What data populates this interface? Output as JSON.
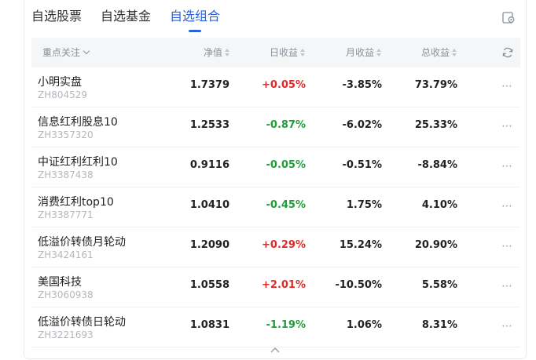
{
  "tabs": [
    {
      "label": "自选股票",
      "active": false
    },
    {
      "label": "自选基金",
      "active": false
    },
    {
      "label": "自选组合",
      "active": true
    }
  ],
  "header": {
    "focus": "重点关注",
    "nav": "净值",
    "day": "日收益",
    "month": "月收益",
    "total": "总收益"
  },
  "colors": {
    "accent": "#2b63d9",
    "up": "#e02a2a",
    "down": "#1f9d3a"
  },
  "rows": [
    {
      "name": "小明实盘",
      "code": "ZH804529",
      "nav": "1.7379",
      "day": "+0.05%",
      "day_dir": "up",
      "month": "-3.85%",
      "total": "73.79%"
    },
    {
      "name": "信息红利股息10",
      "code": "ZH3357320",
      "nav": "1.2533",
      "day": "-0.87%",
      "day_dir": "down",
      "month": "-6.02%",
      "total": "25.33%"
    },
    {
      "name": "中证红利红利10",
      "code": "ZH3387438",
      "nav": "0.9116",
      "day": "-0.05%",
      "day_dir": "down",
      "month": "-0.51%",
      "total": "-8.84%"
    },
    {
      "name": "消费红利top10",
      "code": "ZH3387771",
      "nav": "1.0410",
      "day": "-0.45%",
      "day_dir": "down",
      "month": "1.75%",
      "total": "4.10%"
    },
    {
      "name": "低溢价转债月轮动",
      "code": "ZH3424161",
      "nav": "1.2090",
      "day": "+0.29%",
      "day_dir": "up",
      "month": "15.24%",
      "total": "20.90%"
    },
    {
      "name": "美国科技",
      "code": "ZH3060938",
      "nav": "1.0558",
      "day": "+2.01%",
      "day_dir": "up",
      "month": "-10.50%",
      "total": "5.58%"
    },
    {
      "name": "低溢价转债日轮动",
      "code": "ZH3221693",
      "nav": "1.0831",
      "day": "-1.19%",
      "day_dir": "down",
      "month": "1.06%",
      "total": "8.31%"
    }
  ],
  "icons": {
    "edit": "edit-square-icon",
    "refresh": "refresh-icon",
    "more": "more-icon",
    "collapse": "chevron-up-icon"
  }
}
